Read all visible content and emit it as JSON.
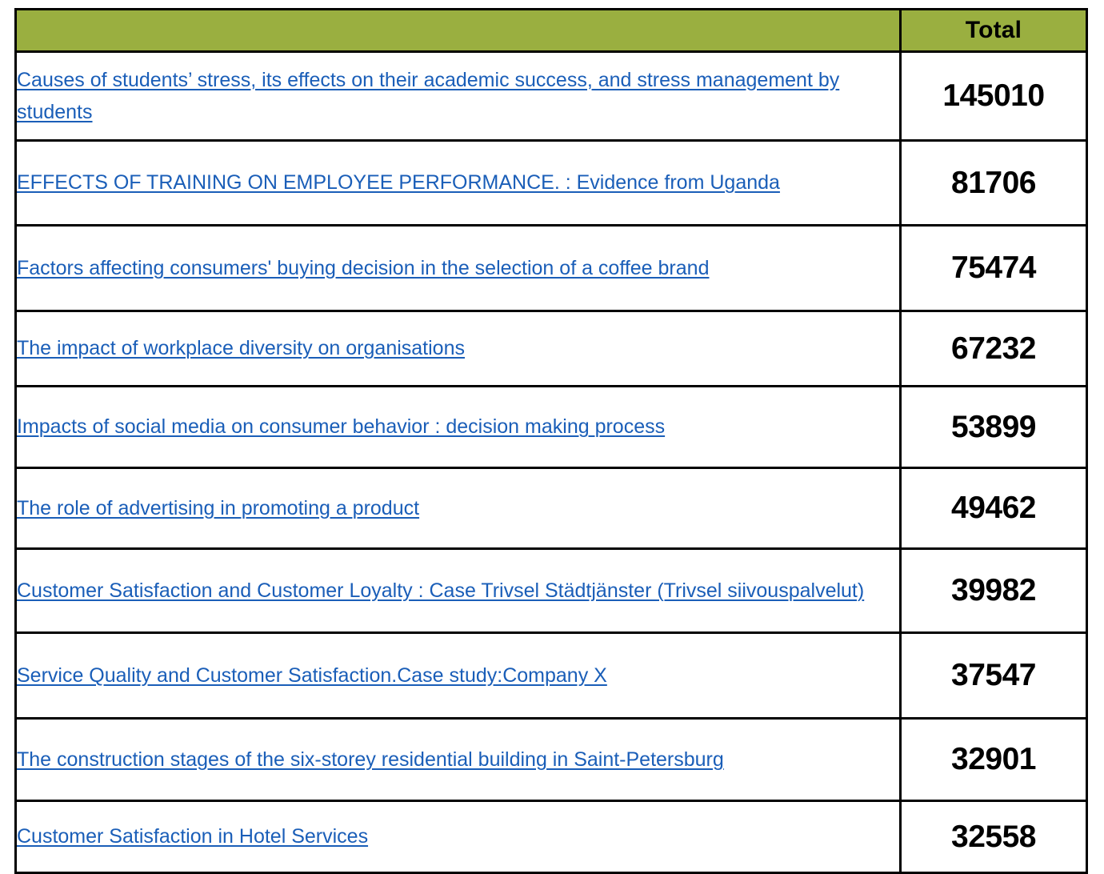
{
  "table": {
    "header": {
      "title_column_label": "",
      "total_column_label": "Total"
    },
    "colors": {
      "header_background": "#9AAF40",
      "link_text": "#1A5EB8",
      "border": "#000000",
      "value_text": "#000000",
      "page_background": "#FFFFFF"
    },
    "rows": [
      {
        "title": "Causes of students’ stress, its effects on their academic success, and stress management by students",
        "total": "145010"
      },
      {
        "title": "EFFECTS OF TRAINING ON EMPLOYEE PERFORMANCE. : Evidence from Uganda",
        "total": "81706"
      },
      {
        "title": "Factors affecting consumers' buying decision in the selection of a coffee brand",
        "total": "75474"
      },
      {
        "title": "The impact of workplace diversity on organisations",
        "total": "67232"
      },
      {
        "title": "Impacts of social media on consumer behavior : decision making process",
        "total": "53899"
      },
      {
        "title": "The role of advertising in promoting a product",
        "total": "49462"
      },
      {
        "title": "Customer Satisfaction and Customer Loyalty : Case Trivsel Städtjänster (Trivsel siivouspalvelut)",
        "total": "39982"
      },
      {
        "title": "Service Quality and Customer Satisfaction.Case study:Company X",
        "total": "37547"
      },
      {
        "title": "The construction stages of the six-storey residential building in Saint-Petersburg",
        "total": "32901"
      },
      {
        "title": "Customer Satisfaction in Hotel Services",
        "total": "32558"
      }
    ]
  }
}
